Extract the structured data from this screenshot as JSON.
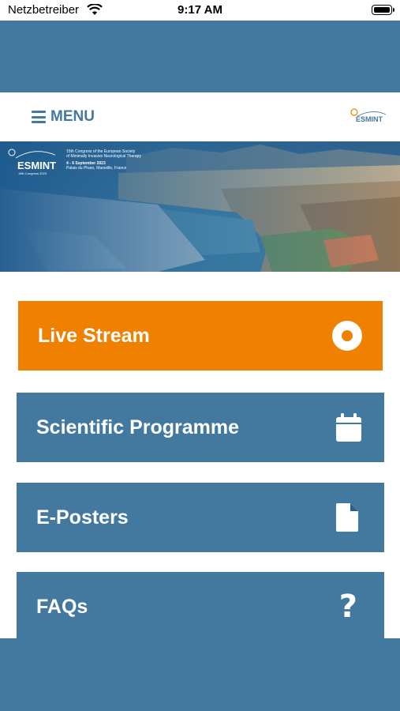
{
  "status_bar": {
    "carrier": "Netzbetreiber",
    "time": "9:17 AM"
  },
  "colors": {
    "primary": "#43789f",
    "accent": "#f08000",
    "white": "#ffffff"
  },
  "menu": {
    "label": "MENU"
  },
  "header_logo": {
    "text": "ESMINT"
  },
  "banner": {
    "logo_text": "ESMINT",
    "logo_sub": "15th Congress 2023",
    "line1": "15th Congress of the European Society",
    "line2": "of Minimally Invasive Neurological Therapy",
    "line3": "4 - 6 September 2023",
    "line4": "Palais du Pharo, Marseille, France"
  },
  "tiles": [
    {
      "label": "Live Stream",
      "icon": "record-circle-icon"
    },
    {
      "label": "Scientific Programme",
      "icon": "calendar-icon"
    },
    {
      "label": "E-Posters",
      "icon": "document-icon"
    },
    {
      "label": "FAQs",
      "icon": "question-mark-icon"
    }
  ]
}
